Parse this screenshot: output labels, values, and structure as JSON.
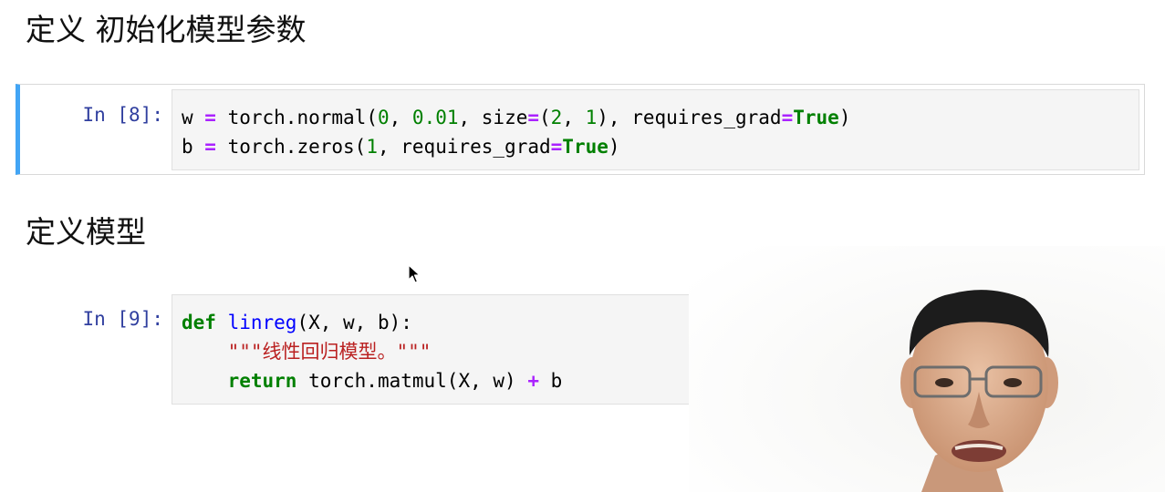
{
  "sections": {
    "heading_init": "定义 初始化模型参数",
    "heading_model": "定义模型"
  },
  "cell8": {
    "prompt": "In [8]:",
    "line1": {
      "a": "w ",
      "eq": "=",
      "b": " torch.normal(",
      "n0": "0",
      "c": ", ",
      "n1": "0.01",
      "d": ", size",
      "eq2": "=",
      "e": "(",
      "n2": "2",
      "f": ", ",
      "n3": "1",
      "g": "), requires_grad",
      "eq3": "=",
      "t": "True",
      "h": ")"
    },
    "line2": {
      "a": "b ",
      "eq": "=",
      "b": " torch.zeros(",
      "n0": "1",
      "c": ", requires_grad",
      "eq2": "=",
      "t": "True",
      "d": ")"
    }
  },
  "cell9": {
    "prompt": "In [9]:",
    "line1": {
      "kw": "def",
      "sp": " ",
      "fn": "linreg",
      "rest": "(X, w, b):"
    },
    "line2": {
      "indent": "    ",
      "doc": "\"\"\"线性回归模型。\"\"\""
    },
    "line3": {
      "indent": "    ",
      "kw": "return",
      "mid": " torch.matmul(X, w) ",
      "op": "+",
      "end": " b"
    }
  },
  "colors": {
    "prompt": "#303f9f",
    "keyword": "#008000",
    "operator": "#aa22ff",
    "function": "#0000ff",
    "string": "#ba2121",
    "selected_cell_bar": "#42a5f5"
  },
  "icons": {
    "cursor": "mouse-pointer-icon"
  }
}
